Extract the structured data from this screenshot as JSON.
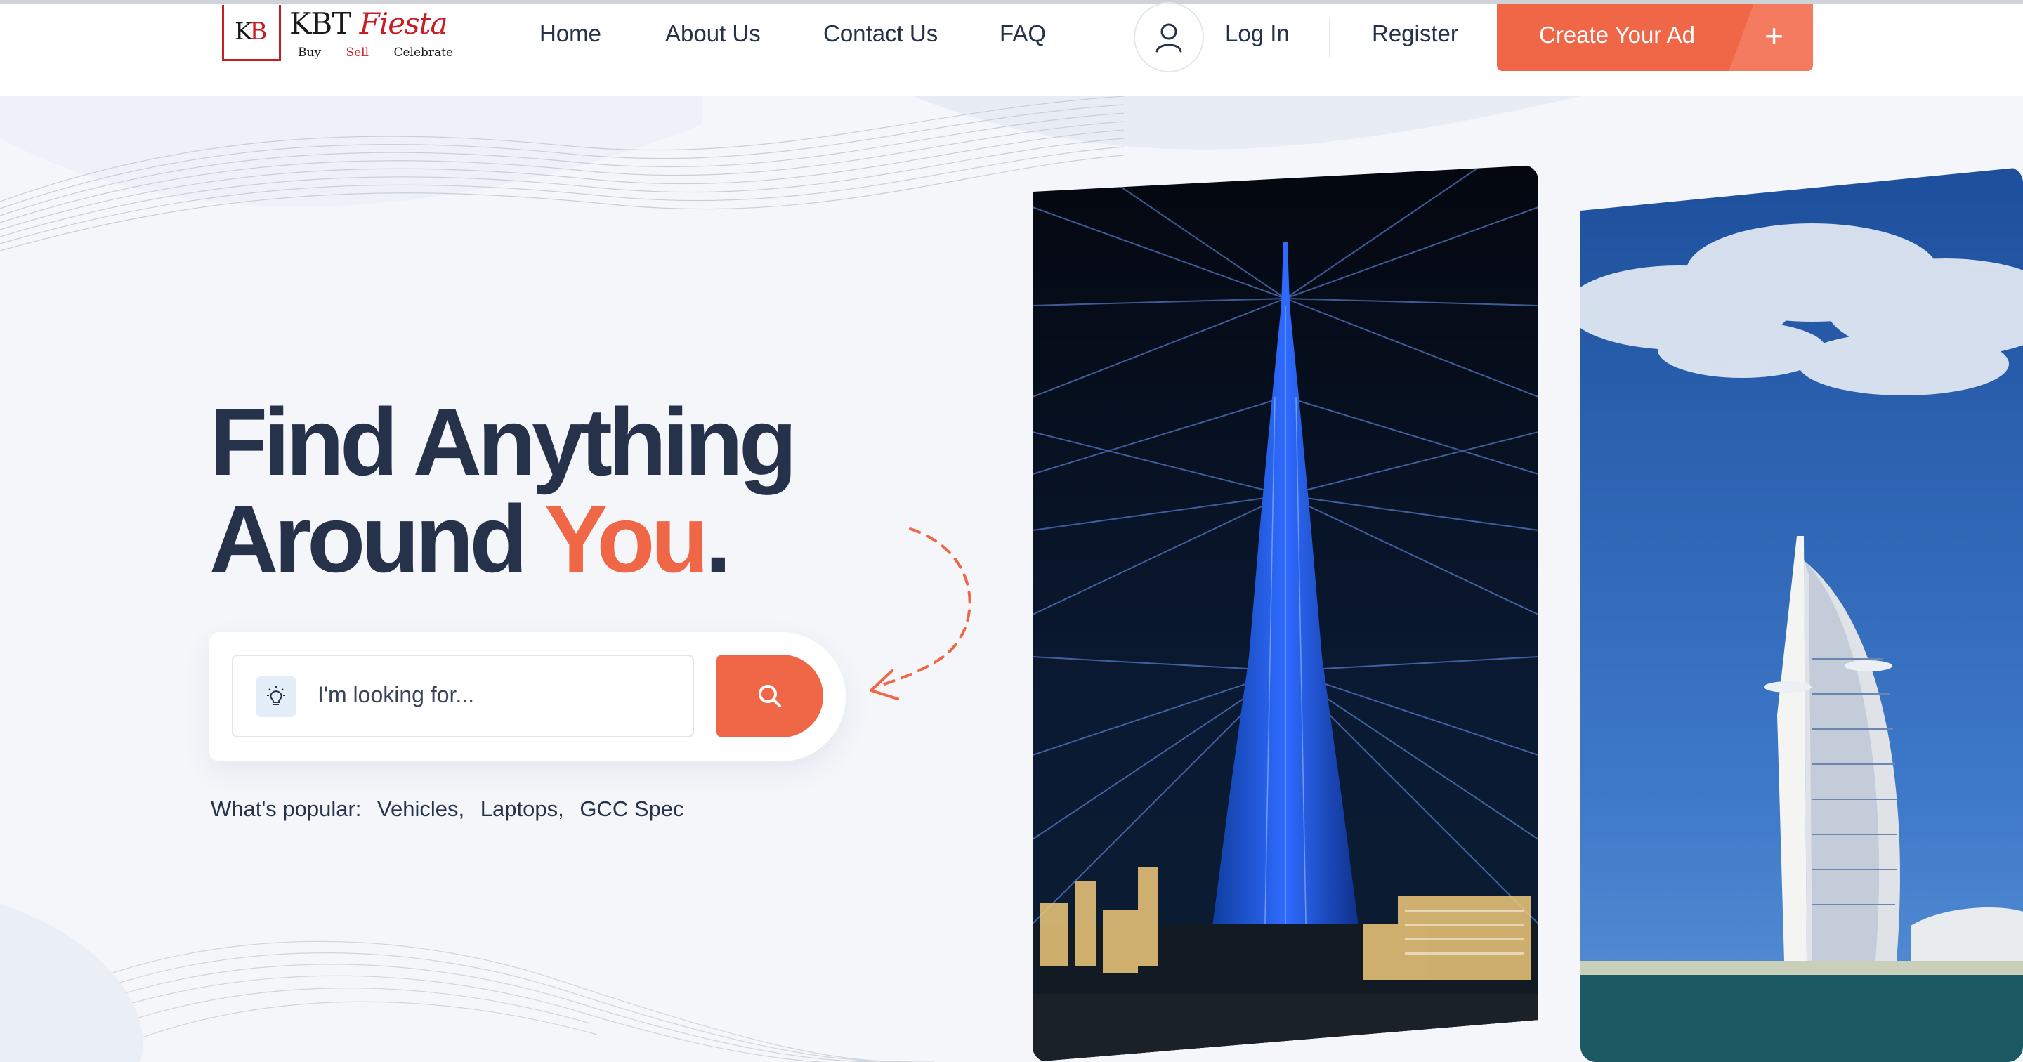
{
  "brand": {
    "monogram_k": "K",
    "monogram_b": "B",
    "name_part1": "KBT",
    "name_part2": "Fiesta",
    "tagline": [
      "Buy",
      "Sell",
      "Celebrate"
    ]
  },
  "nav": {
    "items": [
      "Home",
      "About Us",
      "Contact Us",
      "FAQ"
    ],
    "login": "Log In",
    "register": "Register",
    "cta": "Create Your Ad",
    "cta_icon": "+"
  },
  "hero": {
    "headline_line1": "Find Anything",
    "headline_line2_a": "Around ",
    "headline_line2_b": "You",
    "headline_line2_c": "."
  },
  "search": {
    "placeholder": "I'm looking for...",
    "icon": "lightbulb-icon",
    "button_icon": "search-icon"
  },
  "popular": {
    "label": "What's popular:",
    "tags": [
      "Vehicles,",
      "Laptops,",
      "GCC Spec"
    ]
  },
  "colors": {
    "accent": "#f06748",
    "text": "#26324a",
    "brand_red": "#c81d25",
    "background": "#f4f6fa"
  }
}
